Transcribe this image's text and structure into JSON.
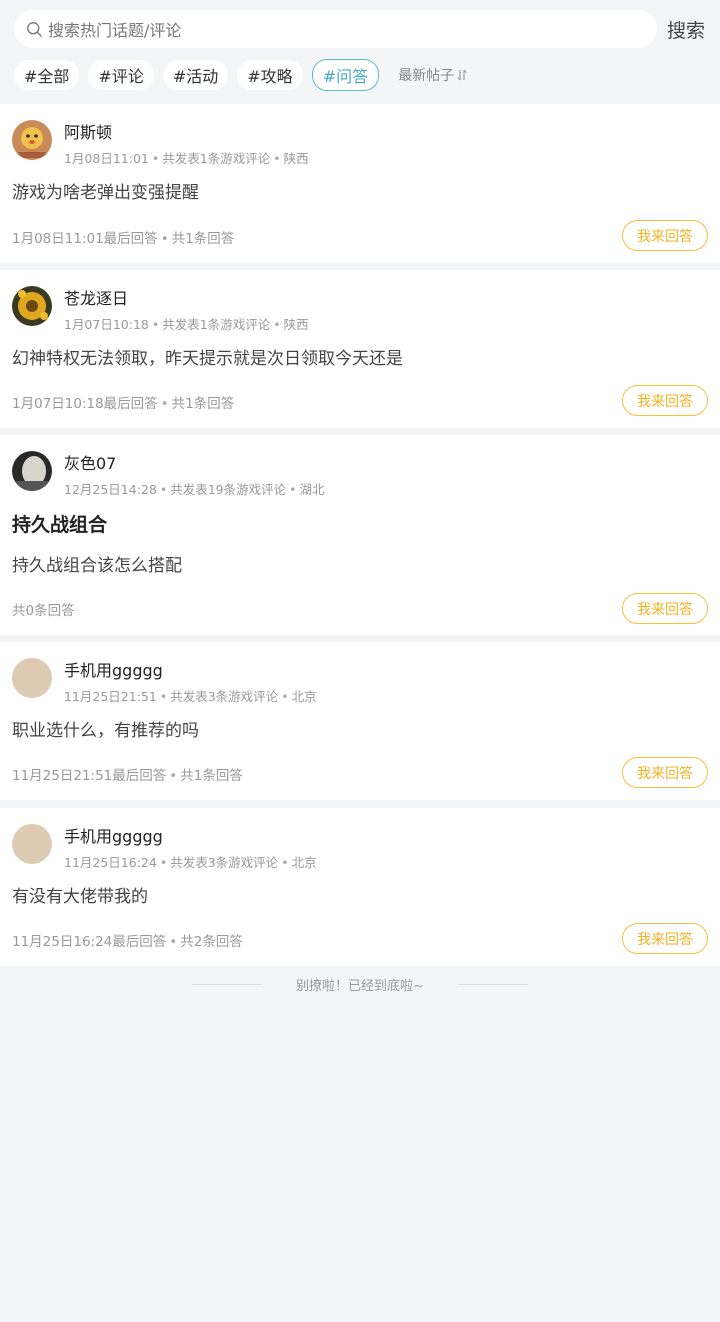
{
  "search": {
    "placeholder": "搜索热门话题/评论",
    "button": "搜索"
  },
  "tags": [
    {
      "label": "#全部"
    },
    {
      "label": "#评论"
    },
    {
      "label": "#活动"
    },
    {
      "label": "#攻略"
    },
    {
      "label": "#问答",
      "active": true
    }
  ],
  "sort": {
    "label": "最新帖子"
  },
  "posts": [
    {
      "user": "阿斯顿",
      "date": "1月08日11:01",
      "stats": "共发表1条游戏评论",
      "region": "陕西",
      "content": "游戏为啥老弹出变强提醒",
      "last_reply": "1月08日11:01最后回答",
      "reply_count": "共1条回答",
      "answer_btn": "我来回答"
    },
    {
      "user": "苍龙逐日",
      "date": "1月07日10:18",
      "stats": "共发表1条游戏评论",
      "region": "陕西",
      "content": "幻神特权无法领取，昨天提示就是次日领取今天还是",
      "last_reply": "1月07日10:18最后回答",
      "reply_count": "共1条回答",
      "answer_btn": "我来回答"
    },
    {
      "user": "灰色07",
      "date": "12月25日14:28",
      "stats": "共发表19条游戏评论",
      "region": "湖北",
      "title": "持久战组合",
      "content": "持久战组合该怎么搭配",
      "reply_count": "共0条回答",
      "answer_btn": "我来回答"
    },
    {
      "user": "手机用ggggg",
      "date": "11月25日21:51",
      "stats": "共发表3条游戏评论",
      "region": "北京",
      "content": "职业选什么，有推荐的吗",
      "last_reply": "11月25日21:51最后回答",
      "reply_count": "共1条回答",
      "answer_btn": "我来回答"
    },
    {
      "user": "手机用ggggg",
      "date": "11月25日16:24",
      "stats": "共发表3条游戏评论",
      "region": "北京",
      "content": "有没有大佬带我的",
      "last_reply": "11月25日16:24最后回答",
      "reply_count": "共2条回答",
      "answer_btn": "我来回答"
    }
  ],
  "footer": {
    "end_text": "别撩啦！已经到底啦~"
  },
  "colors": {
    "accent_answer": "#f0b323",
    "accent_tag": "#46aac3",
    "bg": "#f4f5f7"
  }
}
